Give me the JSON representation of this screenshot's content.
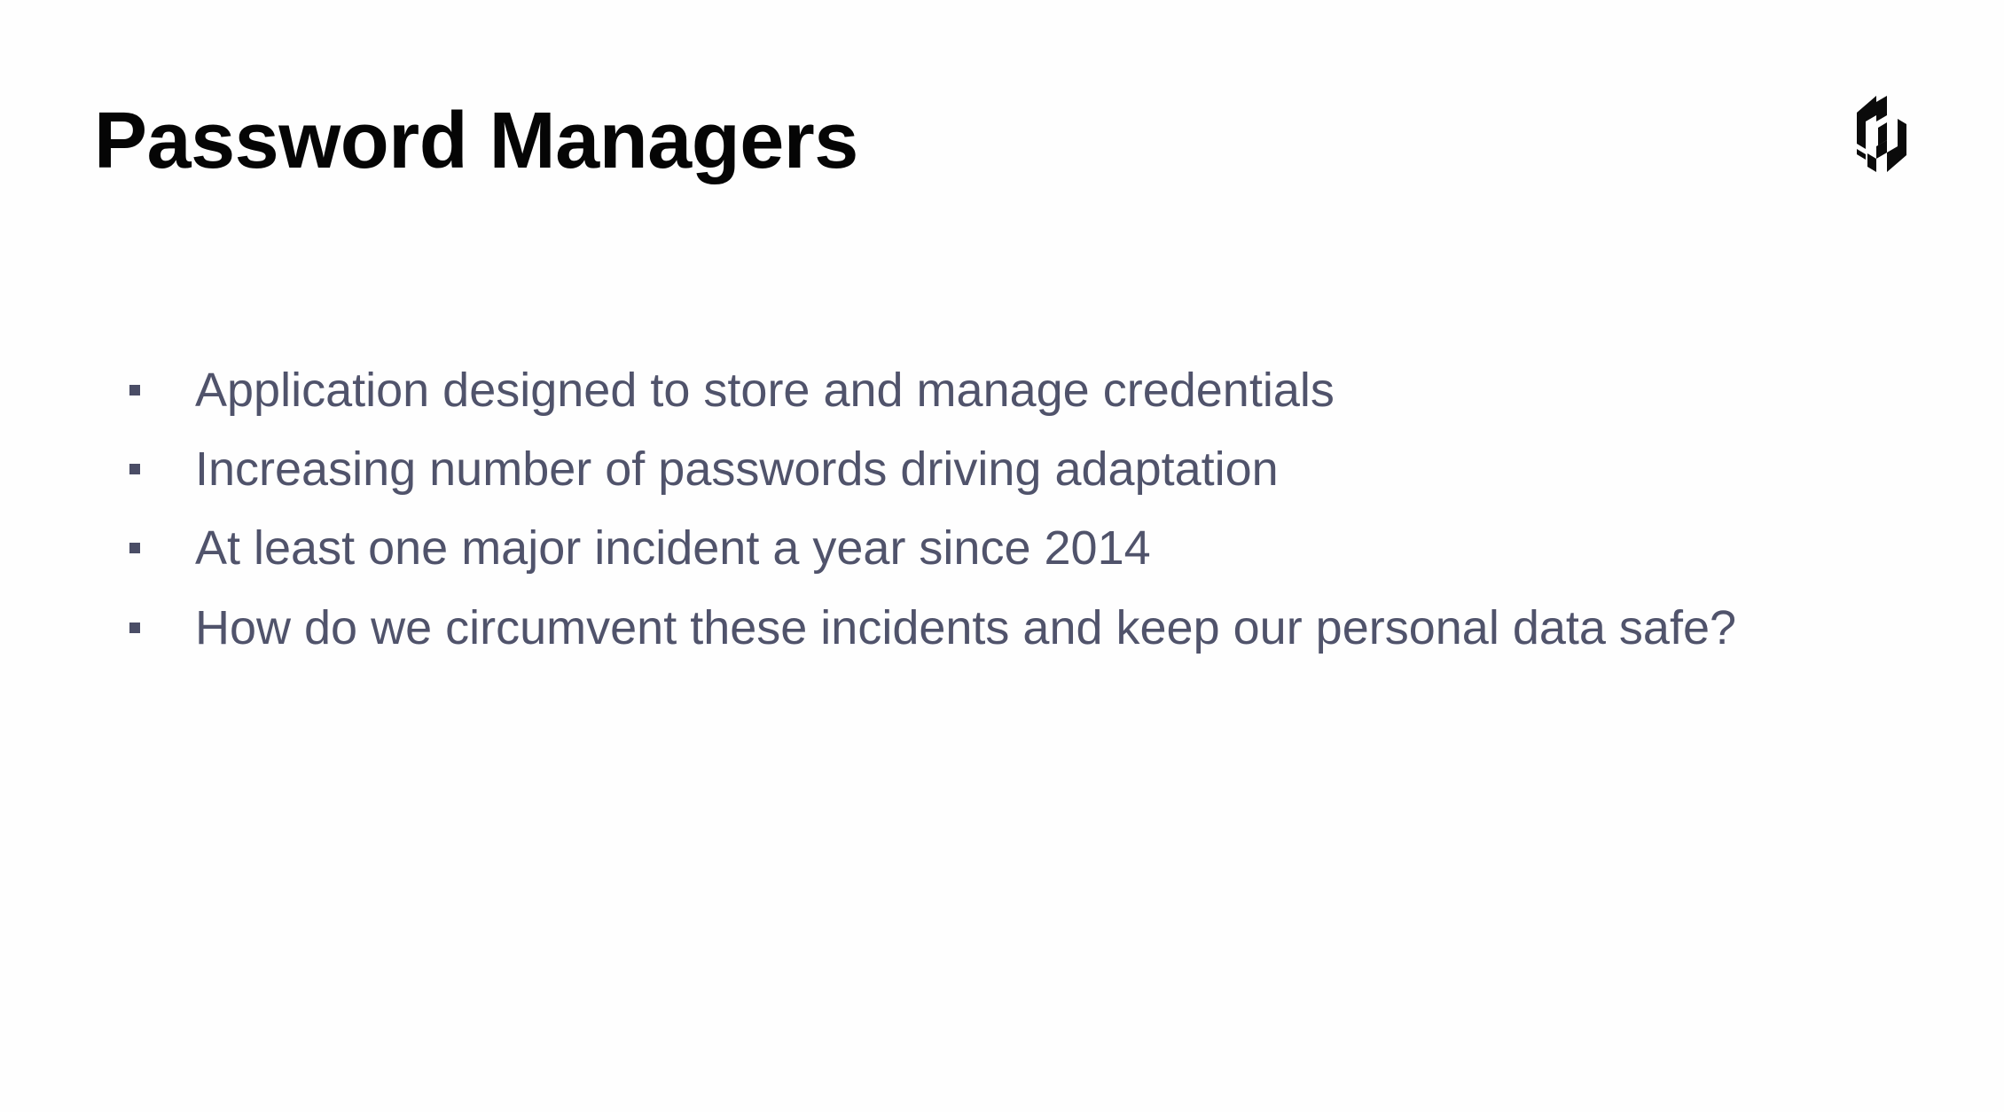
{
  "slide": {
    "title": "Password Managers",
    "logo_icon": "hashicorp-logo-icon",
    "bullets": [
      "Application designed to store and manage credentials",
      "Increasing number of passwords driving adaptation",
      "At least one major incident a year since 2014",
      "How do we circumvent these incidents and keep our personal data safe?"
    ]
  },
  "colors": {
    "title": "#050505",
    "body_text": "#50536b",
    "background": "#fefefe"
  }
}
